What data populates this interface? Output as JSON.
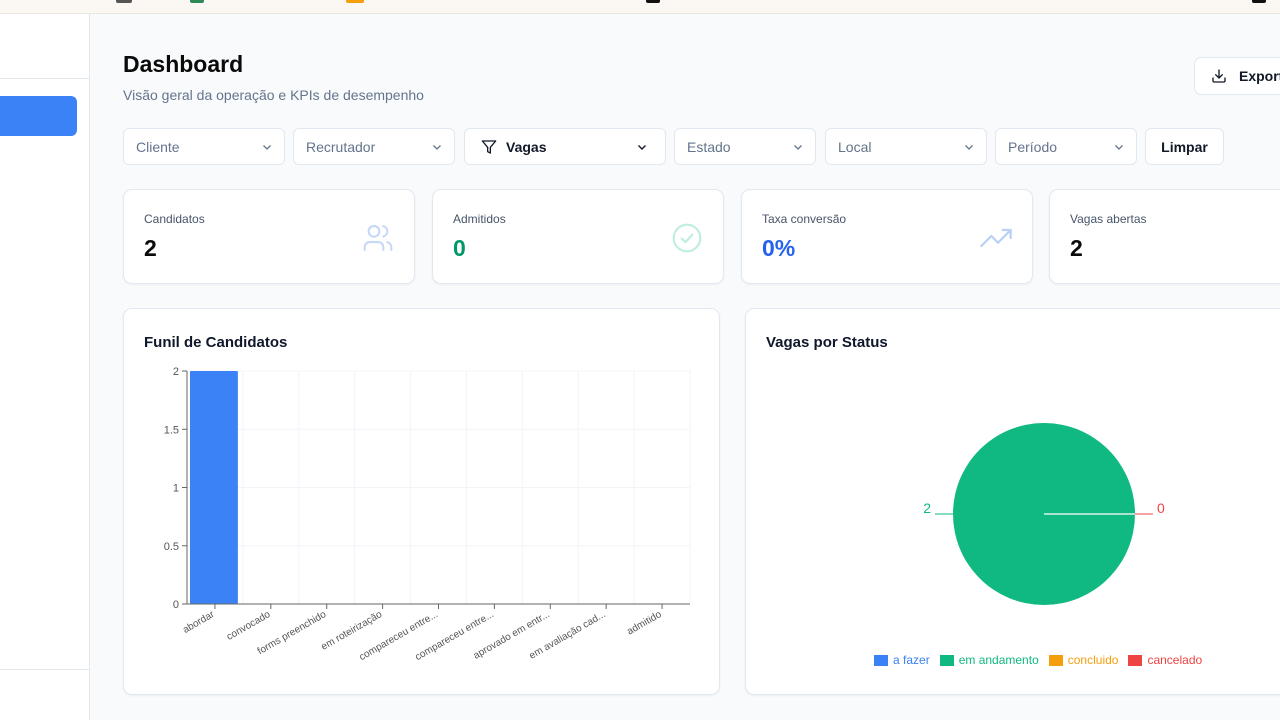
{
  "header": {
    "title": "Dashboard",
    "subtitle": "Visão geral da operação e KPIs de desempenho",
    "export_label": "Export"
  },
  "filters": [
    {
      "label": "Cliente"
    },
    {
      "label": "Recrutador"
    },
    {
      "label": "Vagas",
      "active": true
    },
    {
      "label": "Estado"
    },
    {
      "label": "Local"
    },
    {
      "label": "Período"
    }
  ],
  "clear_label": "Limpar",
  "kpis": [
    {
      "label": "Candidatos",
      "value": "2",
      "icon": "users-icon",
      "color": "#0a0a0a"
    },
    {
      "label": "Admitidos",
      "value": "0",
      "icon": "check-circle-icon",
      "color": "#059669"
    },
    {
      "label": "Taxa conversão",
      "value": "0%",
      "icon": "trending-up-icon",
      "color": "#2563eb"
    },
    {
      "label": "Vagas abertas",
      "value": "2",
      "icon": "briefcase-icon",
      "color": "#0a0a0a"
    }
  ],
  "colors": {
    "accent": "#3b82f6",
    "green": "#10b981",
    "amber": "#f59e0b",
    "red": "#ef4444"
  },
  "chart_data": [
    {
      "type": "bar",
      "title": "Funil de Candidatos",
      "categories": [
        "abordar",
        "convocado",
        "forms preenchido",
        "em roteirização",
        "compareceu entre...",
        "compareceu entre...",
        "aprovado em entr...",
        "em avaliação cad...",
        "admitido"
      ],
      "values": [
        2,
        0,
        0,
        0,
        0,
        0,
        0,
        0,
        0
      ],
      "yticks": [
        "0",
        "0.5",
        "1",
        "1.5",
        "2"
      ],
      "ylim": [
        0,
        2
      ],
      "grid": true
    },
    {
      "type": "pie",
      "title": "Vagas por Status",
      "slices": [
        {
          "name": "a fazer",
          "value": 0,
          "color": "#3b82f6"
        },
        {
          "name": "em andamento",
          "value": 2,
          "color": "#10b981"
        },
        {
          "name": "concluido",
          "value": 0,
          "color": "#f59e0b"
        },
        {
          "name": "cancelado",
          "value": 0,
          "color": "#ef4444"
        }
      ],
      "slice_labels": {
        "left": "2",
        "right": "0"
      }
    }
  ]
}
